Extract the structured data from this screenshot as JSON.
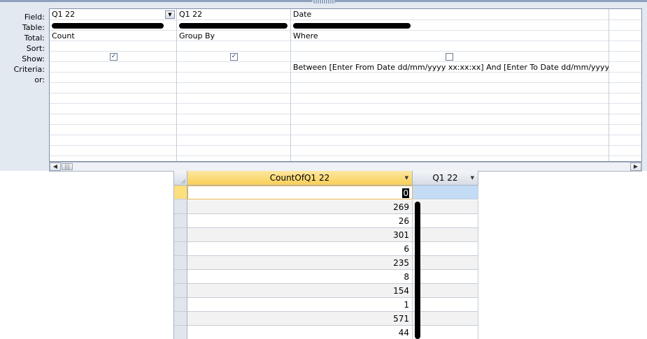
{
  "design": {
    "row_labels": [
      "Field:",
      "Table:",
      "Total:",
      "Sort:",
      "Show:",
      "Criteria:",
      "or:"
    ],
    "columns": [
      {
        "field": "Q1 22",
        "total": "Count",
        "sort": "",
        "show": true,
        "criteria": "",
        "has_dropdown": true
      },
      {
        "field": "Q1 22",
        "total": "Group By",
        "sort": "",
        "show": true,
        "criteria": "",
        "has_dropdown": false
      },
      {
        "field": "Date",
        "total": "Where",
        "sort": "",
        "show": false,
        "criteria": "Between [Enter From Date dd/mm/yyyy xx:xx:xx] And [Enter To Date dd/mm/yyyy xx:xx:xx]",
        "has_dropdown": false
      },
      {
        "field": "",
        "total": "",
        "sort": "",
        "show": null,
        "criteria": "",
        "has_dropdown": false
      }
    ],
    "icons": {
      "dropdown": "chevron-down-icon",
      "scroll_left": "arrow-left-icon",
      "scroll_right": "arrow-right-icon",
      "check": "checkmark-icon"
    }
  },
  "datasheet": {
    "headers": [
      "CountOfQ1 22",
      "Q1 22"
    ],
    "current_row_value": "0",
    "rows": [
      "269",
      "26",
      "301",
      "6",
      "235",
      "8",
      "154",
      "1",
      "571",
      "44"
    ]
  },
  "colors": {
    "panel_bg": "#e3e9f1",
    "header_selected": "#f9cf57",
    "current_row_selector": "#fddf7e",
    "current_cell_highlight": "#c3dbf5",
    "redaction": "#000000"
  }
}
